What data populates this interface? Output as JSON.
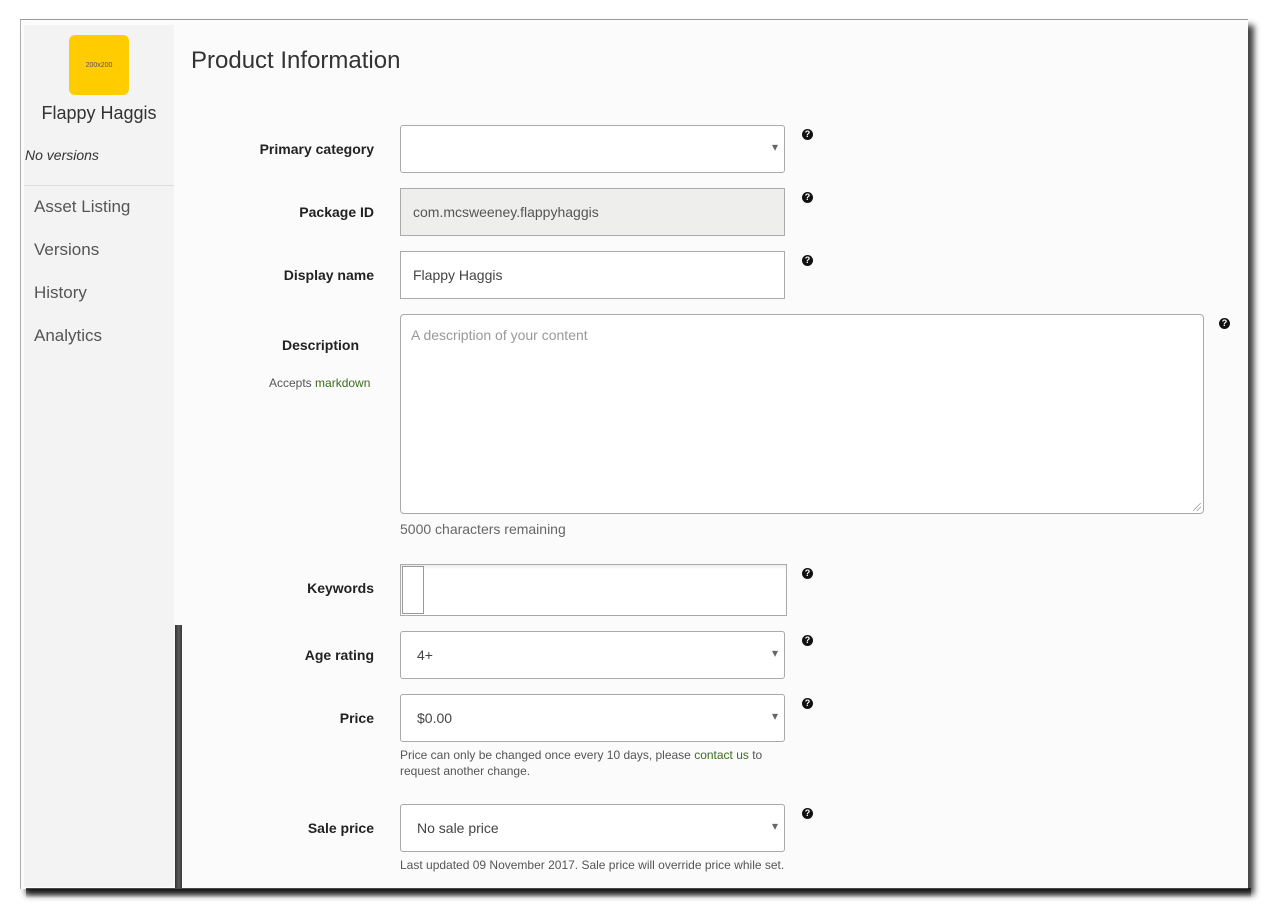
{
  "sidebar": {
    "logo_text": "200x200",
    "app_name": "Flappy Haggis",
    "versions_note": "No versions",
    "nav": [
      {
        "label": "Asset Listing"
      },
      {
        "label": "Versions"
      },
      {
        "label": "History"
      },
      {
        "label": "Analytics"
      }
    ]
  },
  "main": {
    "title": "Product Information",
    "help_glyph": "?",
    "fields": {
      "primary_category": {
        "label": "Primary category",
        "value": ""
      },
      "package_id": {
        "label": "Package ID",
        "value": "com.mcsweeney.flappyhaggis"
      },
      "display_name": {
        "label": "Display name",
        "value": "Flappy Haggis"
      },
      "description": {
        "label": "Description",
        "hint_prefix": "Accepts ",
        "hint_link": "markdown",
        "placeholder": "A description of your content",
        "value": "",
        "chars_remaining": "5000 characters remaining"
      },
      "keywords": {
        "label": "Keywords",
        "value": ""
      },
      "age_rating": {
        "label": "Age rating",
        "value": "4+"
      },
      "price": {
        "label": "Price",
        "value": "$0.00",
        "note_prefix": "Price can only be changed once every 10 days, please ",
        "note_link": "contact us",
        "note_suffix": " to request another change."
      },
      "sale_price": {
        "label": "Sale price",
        "value": "No sale price",
        "note": "Last updated 09 November 2017. Sale price will override price while set."
      }
    }
  },
  "colors": {
    "logo": "#ffcc00",
    "link": "#3d6b1e",
    "sidebar_bg": "#f3f3f3",
    "main_bg": "#fbfbfb"
  }
}
